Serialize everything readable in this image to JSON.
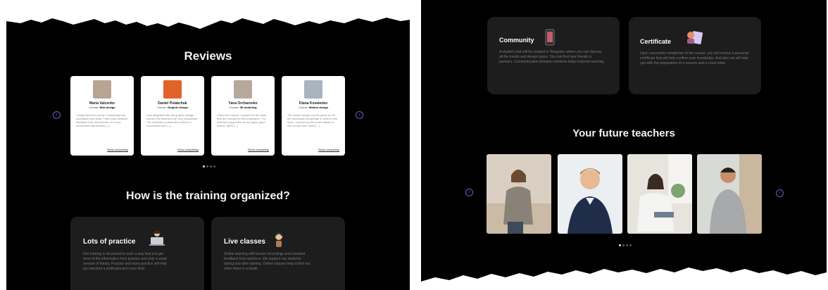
{
  "left_page": {
    "reviews_title": "Reviews",
    "reviews": [
      {
        "name": "Maria Valcenko",
        "course_label": "Course:",
        "course": "Web design",
        "text": "I really liked the course. Everything was accessible and clear. There was constant feedback from the teacher. It is very convenient that access [...]",
        "read_more": "Read completely",
        "photo_bg": "#b9a493"
      },
      {
        "name": "Daniel Pulakchuk",
        "course_label": "Course:",
        "course": "Graphic design",
        "text": "I am delighted with the graphic design course, the teachers are very responsive. The material is presented audio in a convenient form [...]",
        "read_more": "Read completely",
        "photo_bg": "#e2622c"
      },
      {
        "name": "Yana Orcharenko",
        "course_label": "Course:",
        "course": "3D modeling",
        "text": "I liked this course. I learned all the skills that are needed for this profession. The teachers supported me and gave good advice, there [...]",
        "read_more": "Read completely",
        "photo_bg": "#b7a89c"
      },
      {
        "name": "Diana Kovalenko",
        "course_label": "Course:",
        "course": "Motion design",
        "text": "The motion design course gave me all the necessary knowledge to work in this area. I earned my first order thanks to this course and I want [...]",
        "read_more": "Read completely",
        "photo_bg": "#a9b4bd"
      }
    ],
    "training_title": "How is the training organized?",
    "features": [
      {
        "title": "Lots of practice",
        "text": "Our training is structured in such a way that you get most of the information from practice and only a small amount of theory. Practice and more practice will help you become a professional in your field."
      },
      {
        "title": "Live classes",
        "text": "Online learning with lecture recordings and constant feedback from teachers. We support our students during and after training. Online classes help to find out when there is a doubt."
      }
    ]
  },
  "right_page": {
    "features": [
      {
        "title": "Community",
        "text": "A student chat will be created in Telegram, where you can discuss all the trends and design topics. You can find new friends or partners. Communication between students helps improve learning."
      },
      {
        "title": "Certificate",
        "text": "Upon successful completion of the course, you will receive a personal certificate that will help confirm your knowledge. And also we will help you with the preparation of a resume and a cover letter."
      }
    ],
    "teachers_title": "Your future teachers"
  },
  "colors": {
    "background": "#000000",
    "card": "#1d1d1d",
    "accent": "#6b5fc4",
    "paper": "#ffffff"
  },
  "icons": [
    "chevron-left-icon",
    "chevron-right-icon",
    "laptop-person-icon",
    "person-headset-icon",
    "phone-icon",
    "certificate-icon"
  ]
}
